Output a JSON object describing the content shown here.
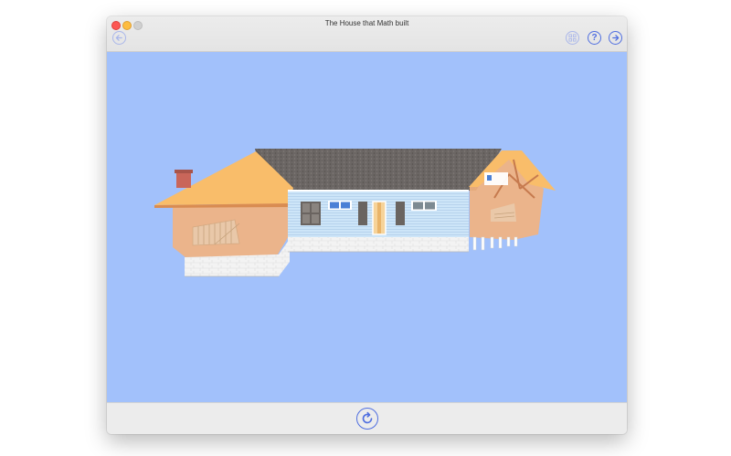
{
  "window": {
    "title": "The House that Math built"
  },
  "toolbar": {
    "back_icon": "arrow-left-circle-icon",
    "grid_icon": "grid-icon",
    "help_label": "?",
    "help_icon": "question-circle-icon",
    "next_icon": "arrow-right-circle-icon"
  },
  "bottom": {
    "reload_icon": "reload-circle-icon"
  },
  "colors": {
    "accent": "#4f6ee0",
    "canvas_bg": "#a2c1fb",
    "roof_orange": "#f9bd6a",
    "roof_shingle": "#6b6664",
    "siding": "#c9e2f7",
    "wall_transparent": "#f3b37e",
    "foundation": "#f2f2f2"
  }
}
